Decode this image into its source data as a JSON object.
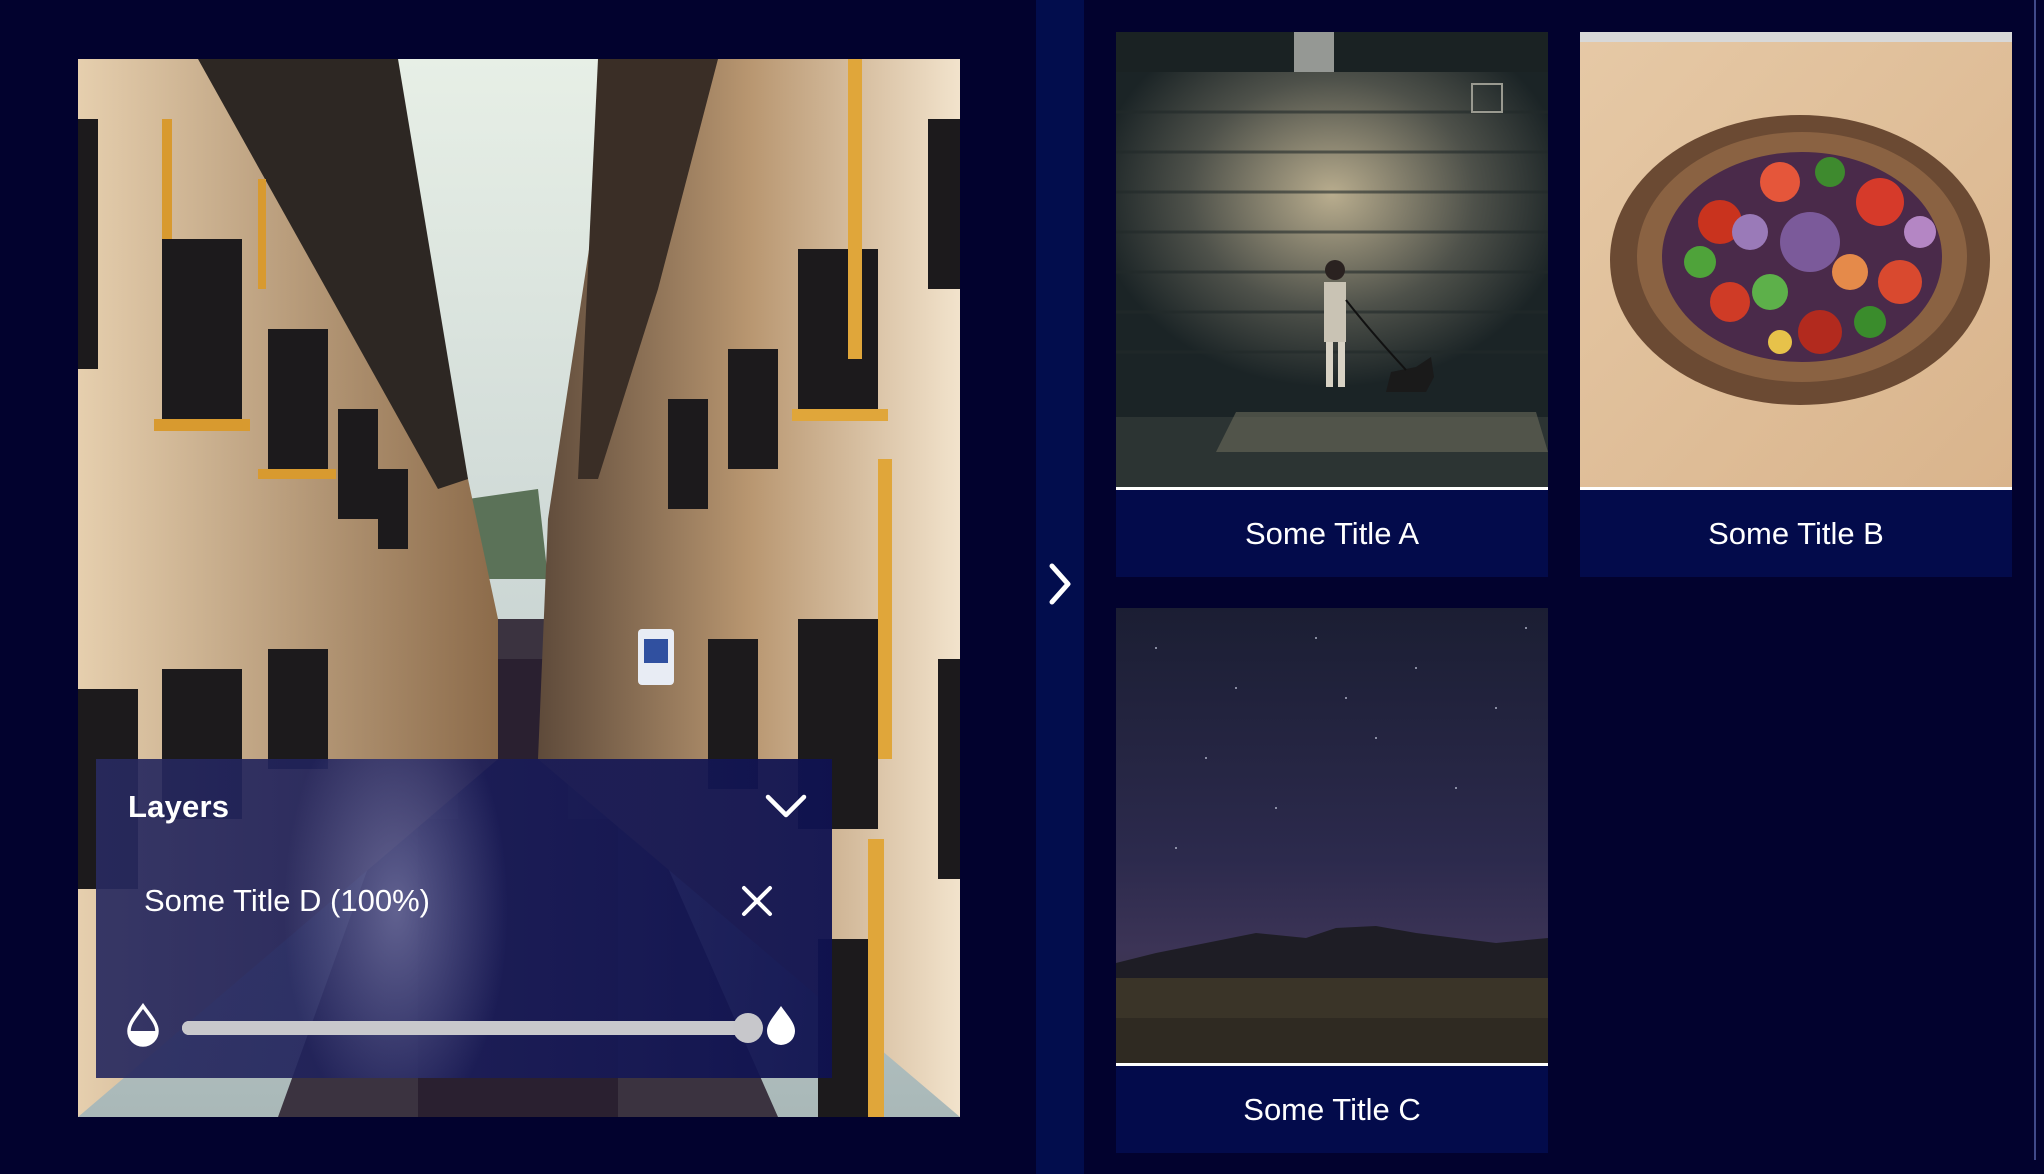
{
  "preview": {
    "image": "street-photo"
  },
  "layers": {
    "title": "Layers",
    "toggle_icon": "chevron-down-icon",
    "items": [
      {
        "label": "Some Title D (100%)",
        "opacity": 1.0
      }
    ],
    "remove_icon": "close-icon",
    "min_opacity_icon": "drop-outline-icon",
    "max_opacity_icon": "drop-filled-icon"
  },
  "side_toggle": {
    "icon": "chevron-right-icon"
  },
  "gallery": [
    {
      "title": "Some Title A",
      "image": "person-dog-wall-photo"
    },
    {
      "title": "Some Title B",
      "image": "salad-bowl-photo"
    },
    {
      "title": "Some Title C",
      "image": "night-sky-photo"
    }
  ],
  "colors": {
    "background": "#02022e",
    "card": "#030b4b",
    "side_bar": "#020d4d",
    "text": "#ffffff",
    "slider": "#d3d3d6"
  }
}
